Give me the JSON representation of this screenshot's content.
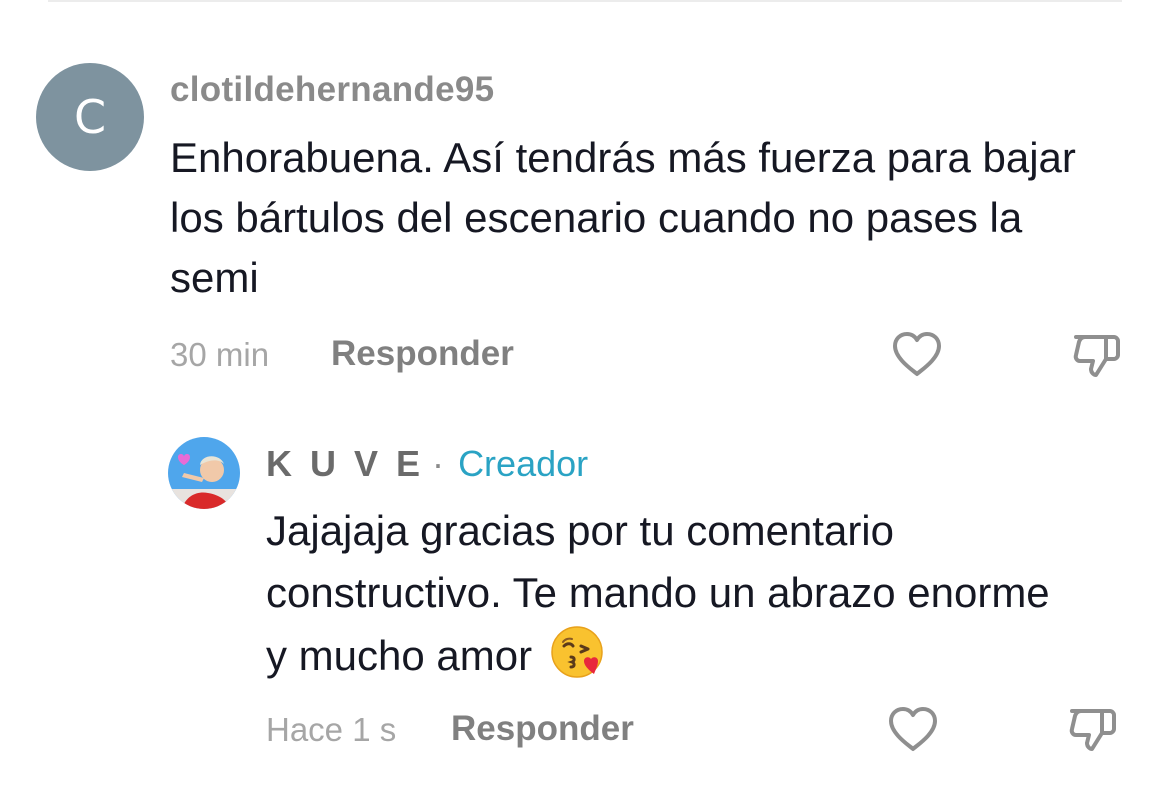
{
  "comment": {
    "avatar_letter": "C",
    "avatar_color": "#7e939f",
    "username": "clotildehernande95",
    "text": "Enhorabuena. Así tendrás más fuerza para bajar los bártulos del escenario cuando no pases la semi",
    "time": "30 min",
    "reply_label": "Responder",
    "like_icon": "heart-outline-icon",
    "dislike_icon": "thumbs-down-icon"
  },
  "reply": {
    "username": "K U V E",
    "separator": "·",
    "badge": "Creador",
    "badge_color": "#2aa3c4",
    "text": "Jajajaja gracias por tu comentario constructivo. Te mando un abrazo enorme y mucho amor",
    "emoji": "face-throwing-kiss-emoji",
    "time": "Hace 1 s",
    "reply_label": "Responder",
    "like_icon": "heart-outline-icon",
    "dislike_icon": "thumbs-down-icon"
  }
}
